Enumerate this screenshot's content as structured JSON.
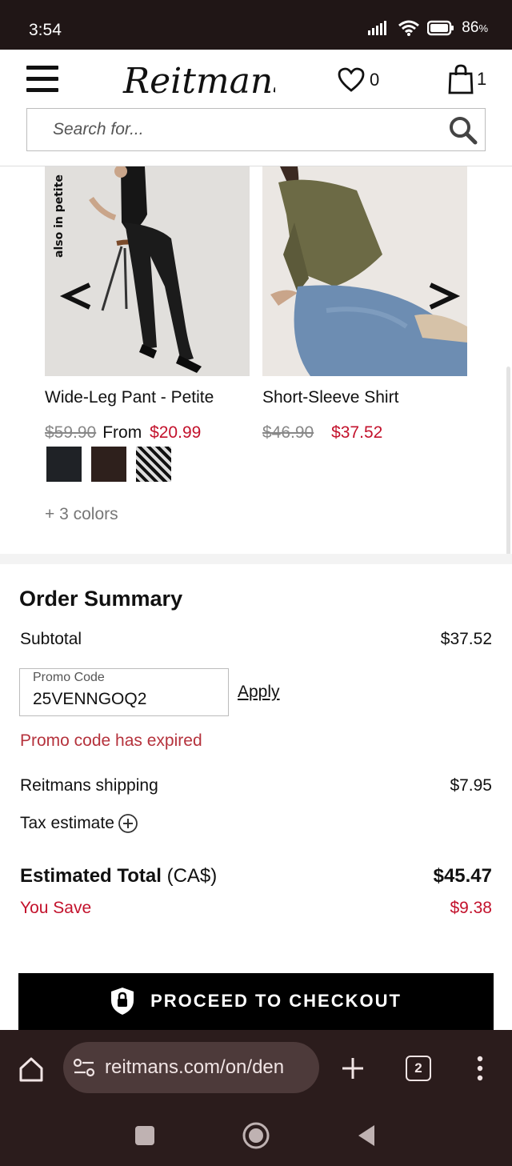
{
  "status_bar": {
    "time": "3:54",
    "battery": "86",
    "battery_unit": "%"
  },
  "header": {
    "brand": "Reitmans",
    "wishlist_count": "0",
    "cart_count": "1",
    "search_placeholder": "Search for..."
  },
  "carousel": {
    "petite_tag": "also in petite",
    "products": [
      {
        "name": "Wide-Leg Pant - Petite",
        "price_old": "$59.90",
        "price_prefix": "From",
        "price_new": "$20.99",
        "swatch_colors": [
          "#1f2226",
          "#2e201c",
          "pattern"
        ],
        "more_colors": "+ 3 colors"
      },
      {
        "name": "Short-Sleeve Shirt",
        "price_old": "$46.90",
        "price_new": "$37.52"
      }
    ]
  },
  "order_summary": {
    "title": "Order Summary",
    "subtotal_label": "Subtotal",
    "subtotal_value": "$37.52",
    "promo_label": "Promo Code",
    "promo_value": "25VENNGOQ2",
    "apply_label": "Apply",
    "promo_error": "Promo code has expired",
    "shipping_label": "Reitmans shipping",
    "shipping_value": "$7.95",
    "tax_label": "Tax estimate",
    "total_label": "Estimated Total",
    "total_currency": "(CA$)",
    "total_value": "$45.47",
    "save_label": "You Save",
    "save_value": "$9.38",
    "checkout_label": "PROCEED TO CHECKOUT"
  },
  "browser": {
    "url": "reitmans.com/on/den",
    "tab_count": "2"
  },
  "colors": {
    "sale_red": "#c3122c",
    "error_red": "#b5323c",
    "browser_bg": "#2b1c1c",
    "status_bg": "#201616"
  }
}
